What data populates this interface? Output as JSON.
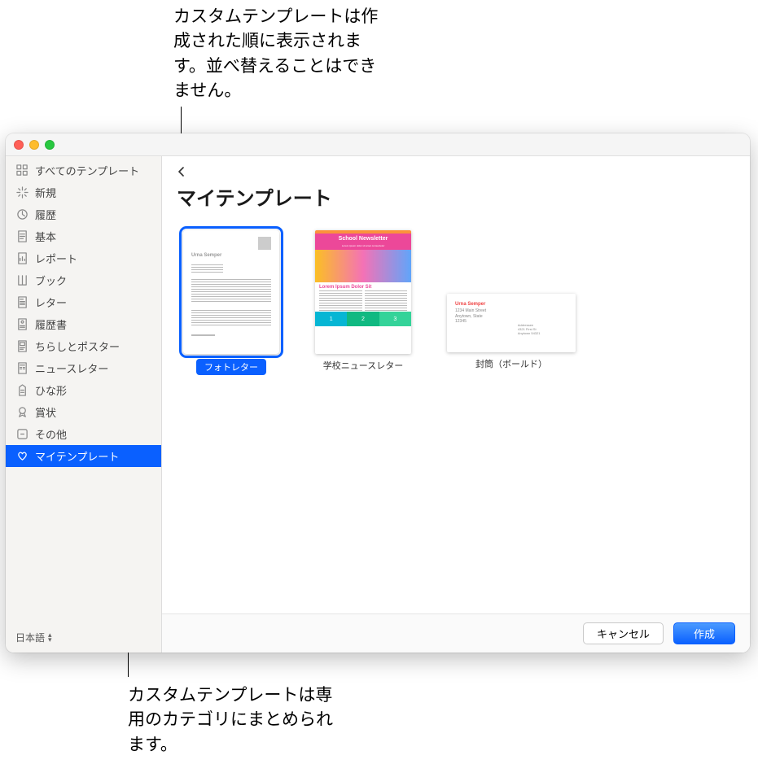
{
  "callouts": {
    "top": "カスタムテンプレートは作成された順に表示されます。並べ替えることはできません。",
    "bottom": "カスタムテンプレートは専用のカテゴリにまとめられます。"
  },
  "sidebar": {
    "items": [
      {
        "label": "すべてのテンプレート",
        "icon": "grid"
      },
      {
        "label": "新規",
        "icon": "sparkle"
      },
      {
        "label": "履歴",
        "icon": "clock"
      },
      {
        "label": "基本",
        "icon": "page"
      },
      {
        "label": "レポート",
        "icon": "report"
      },
      {
        "label": "ブック",
        "icon": "book"
      },
      {
        "label": "レター",
        "icon": "letter"
      },
      {
        "label": "履歴書",
        "icon": "resume"
      },
      {
        "label": "ちらしとポスター",
        "icon": "poster"
      },
      {
        "label": "ニュースレター",
        "icon": "newsletter"
      },
      {
        "label": "ひな形",
        "icon": "stationery"
      },
      {
        "label": "賞状",
        "icon": "award"
      },
      {
        "label": "その他",
        "icon": "other"
      },
      {
        "label": "マイテンプレート",
        "icon": "heart",
        "selected": true
      }
    ],
    "language": "日本語"
  },
  "main": {
    "title": "マイテンプレート",
    "templates": [
      {
        "label": "フォトレター",
        "kind": "photo-letter",
        "shape": "portrait",
        "selected": true
      },
      {
        "label": "学校ニュースレター",
        "kind": "newsletter",
        "shape": "portrait",
        "selected": false
      },
      {
        "label": "封筒（ボールド）",
        "kind": "envelope",
        "shape": "envelope",
        "selected": false
      }
    ]
  },
  "thumbnails": {
    "photo_letter_name": "Urna Semper",
    "newsletter_title": "School Newsletter",
    "newsletter_lorem": "Lorem Ipsum Dolor Sit",
    "envelope_from": "Urna Semper"
  },
  "footer": {
    "cancel": "キャンセル",
    "create": "作成"
  }
}
